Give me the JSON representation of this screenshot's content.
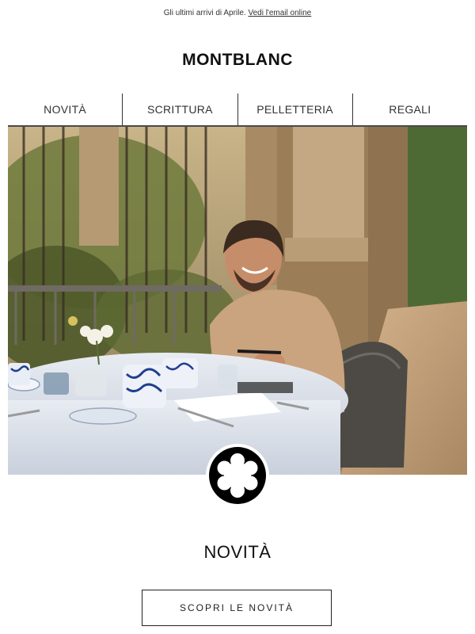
{
  "preheader": {
    "text": "Gli ultimi arrivi di Aprile.",
    "link": "Vedi l'email online"
  },
  "brand": {
    "logo_text": "MONTBLANC"
  },
  "nav": {
    "items": [
      {
        "label": "NOVITÀ"
      },
      {
        "label": "SCRITTURA"
      },
      {
        "label": "PELLETTERIA"
      },
      {
        "label": "REGALI"
      }
    ]
  },
  "hero": {
    "icon": "montblanc-snowcap-emblem"
  },
  "section": {
    "title": "NOVITÀ",
    "cta_label": "SCOPRI LE NOVITÀ"
  }
}
